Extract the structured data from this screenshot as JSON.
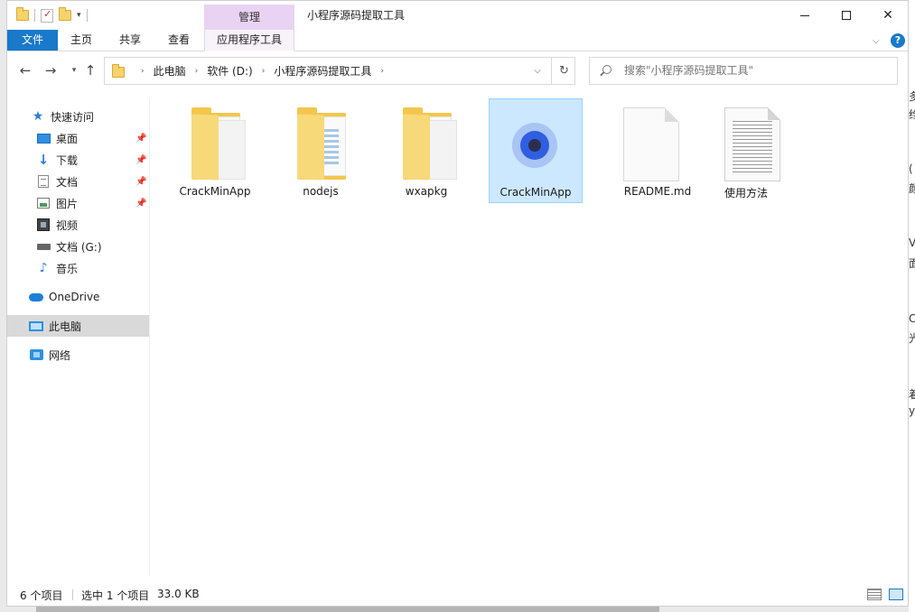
{
  "window": {
    "title": "小程序源码提取工具",
    "contextual_tab_group": "管理"
  },
  "ribbon": {
    "tabs": [
      "文件",
      "主页",
      "共享",
      "查看",
      "应用程序工具"
    ],
    "help": "?"
  },
  "address": {
    "crumbs": [
      "此电脑",
      "软件 (D:)",
      "小程序源码提取工具"
    ]
  },
  "search": {
    "placeholder": "搜索\"小程序源码提取工具\""
  },
  "sidebar": {
    "items": [
      {
        "label": "快速访问",
        "icon": "star-icon",
        "pinned": false
      },
      {
        "label": "桌面",
        "icon": "desktop-icon",
        "pinned": true
      },
      {
        "label": "下载",
        "icon": "download-icon",
        "pinned": true
      },
      {
        "label": "文档",
        "icon": "document-icon",
        "pinned": true
      },
      {
        "label": "图片",
        "icon": "pictures-icon",
        "pinned": true
      },
      {
        "label": "视频",
        "icon": "video-icon",
        "pinned": false
      },
      {
        "label": "文档 (G:)",
        "icon": "drive-icon",
        "pinned": false
      },
      {
        "label": "音乐",
        "icon": "music-icon",
        "pinned": false
      },
      {
        "label": "OneDrive",
        "icon": "cloud-icon",
        "pinned": false
      },
      {
        "label": "此电脑",
        "icon": "computer-icon",
        "pinned": false,
        "selected": true
      },
      {
        "label": "网络",
        "icon": "network-icon",
        "pinned": false
      }
    ]
  },
  "files": [
    {
      "name": "CrackMinApp",
      "type": "folder"
    },
    {
      "name": "nodejs",
      "type": "folder"
    },
    {
      "name": "wxapkg",
      "type": "folder"
    },
    {
      "name": "CrackMinApp",
      "type": "application",
      "selected": true
    },
    {
      "name": "README.md",
      "type": "file"
    },
    {
      "name": "使用方法",
      "type": "text"
    }
  ],
  "status": {
    "count": "6 个项目",
    "selected": "选中 1 个项目",
    "size": "33.0 KB"
  },
  "colors": {
    "accent": "#1979ca",
    "manage_tab": "#e9d3f3",
    "selection": "#cce8ff",
    "folder": "#f4c64c"
  },
  "background_window": {
    "fragments": [
      "多",
      "绉",
      "(",
      "颜",
      "V",
      "面",
      "C",
      "光",
      "着",
      "y"
    ]
  }
}
